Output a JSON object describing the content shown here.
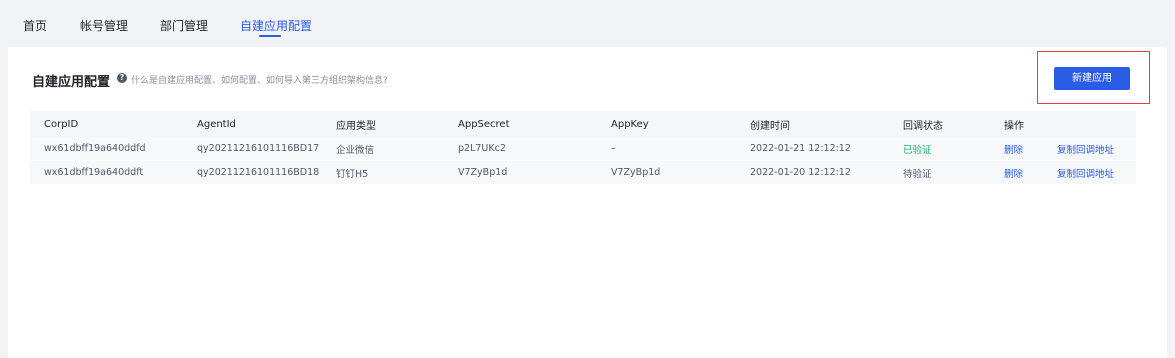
{
  "nav": {
    "items": [
      {
        "label": "首页",
        "active": false
      },
      {
        "label": "帐号管理",
        "active": false
      },
      {
        "label": "部门管理",
        "active": false
      },
      {
        "label": "自建应用配置",
        "active": true
      }
    ]
  },
  "page": {
    "title": "自建应用配置",
    "help_text": "什么是自建应用配置、如何配置、如何导入第三方组织架构信息?",
    "help_icon": "question-circle-icon",
    "new_button_label": "新建应用"
  },
  "table": {
    "headers": [
      "CorpID",
      "AgentId",
      "应用类型",
      "AppSecret",
      "AppKey",
      "创建时间",
      "回调状态",
      "操作",
      ""
    ],
    "rows": [
      {
        "corp_id": "wx61dbff19a640ddfd",
        "agent_id": "qy20211216101116BD17",
        "app_type": "企业微信",
        "app_secret": "p2L7UKc2",
        "app_key": "–",
        "created_at": "2022-01-21 12:12:12",
        "callback_status": "已验证",
        "delete_label": "删除",
        "copy_label": "复制回调地址"
      },
      {
        "corp_id": "wx61dbff19a640ddft",
        "agent_id": "qy20211216101116BD18",
        "app_type": "钉钉H5",
        "app_secret": "V7ZyBp1d",
        "app_key": "V7ZyBp1d",
        "created_at": "2022-01-20 12:12:12",
        "callback_status": "待验证",
        "delete_label": "删除",
        "copy_label": "复制回调地址"
      }
    ]
  },
  "colors": {
    "accent": "#2b5ce6",
    "verified": "#23b06a",
    "highlight": "#e5413a"
  }
}
